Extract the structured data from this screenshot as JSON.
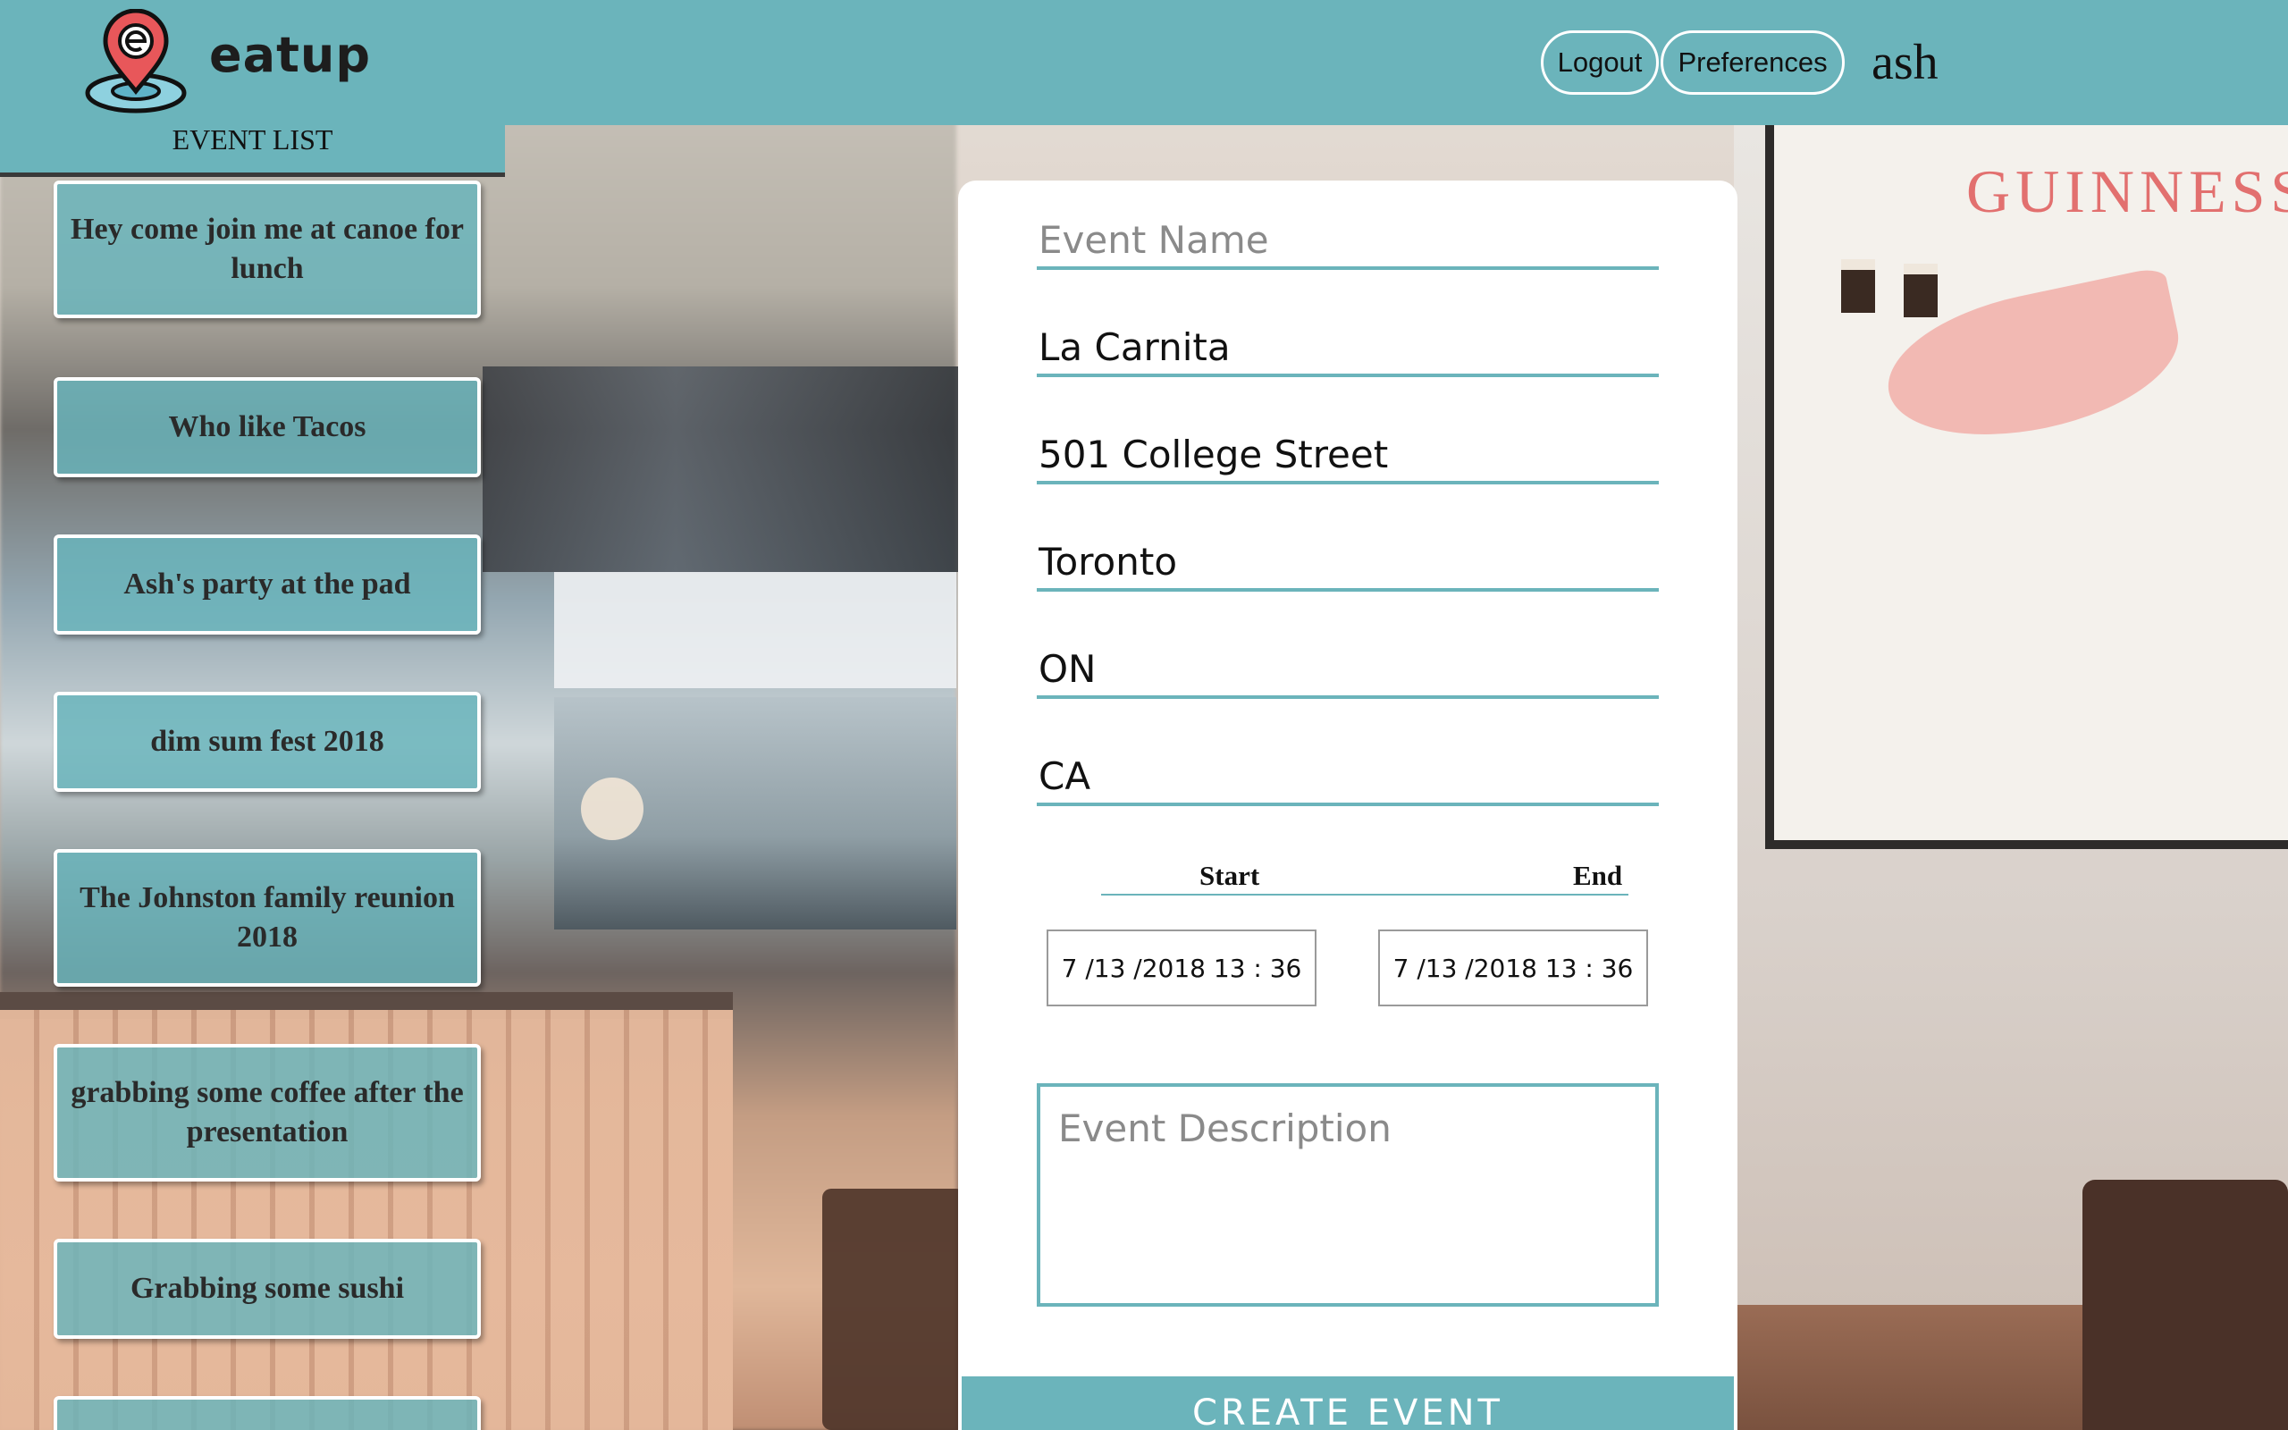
{
  "header": {
    "brand": "eatup",
    "logout_label": "Logout",
    "preferences_label": "Preferences",
    "username": "ash",
    "accent_color": "#6bb4bb"
  },
  "background": {
    "poster_text": "GUINNESS"
  },
  "sidebar": {
    "title": "EVENT LIST",
    "events": [
      "Hey come join me at canoe for lunch",
      "Who like Tacos",
      "Ash's party at the pad",
      "dim sum fest 2018",
      "The Johnston family reunion 2018",
      "grabbing some coffee after the presentation",
      "Grabbing some sushi",
      ""
    ]
  },
  "form": {
    "event_name_placeholder": "Event Name",
    "venue": "La Carnita",
    "address": "501 College Street",
    "city": "Toronto",
    "province": "ON",
    "country": "CA",
    "start_label": "Start",
    "end_label": "End",
    "start_value": "7 /13 /2018  13 : 36",
    "end_value": "7 /13 /2018  13 : 36",
    "description_placeholder": "Event Description",
    "submit_label": "CREATE EVENT"
  }
}
